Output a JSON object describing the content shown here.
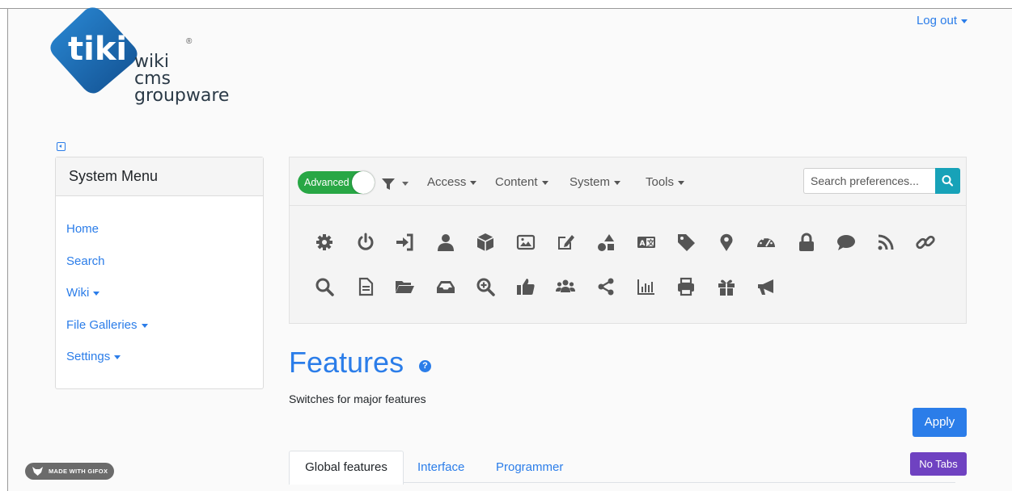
{
  "app": {
    "brand_line1": "wiki",
    "brand_line2": "cms",
    "brand_line3": "groupware",
    "logo_word": "tiki",
    "registered": "®"
  },
  "header": {
    "logout_label": "Log out"
  },
  "sidebar": {
    "title": "System Menu",
    "items": [
      {
        "label": "Home",
        "dropdown": false
      },
      {
        "label": "Search",
        "dropdown": false
      },
      {
        "label": "Wiki",
        "dropdown": true
      },
      {
        "label": "File Galleries",
        "dropdown": true
      },
      {
        "label": "Settings",
        "dropdown": true
      }
    ]
  },
  "admin_bar": {
    "toggle_label": "Advanced",
    "menus": [
      "Access",
      "Content",
      "System",
      "Tools"
    ],
    "search_placeholder": "Search preferences...",
    "icons_row1": [
      "gear-icon",
      "power-icon",
      "login-icon",
      "user-icon",
      "cube-icon",
      "image-icon",
      "edit-icon",
      "shapes-icon",
      "language-icon",
      "tag-icon",
      "map-marker-icon",
      "gauge-icon",
      "lock-icon",
      "comment-icon",
      "rss-icon",
      "link-icon"
    ],
    "icons_row2": [
      "search-icon",
      "file-icon",
      "folder-open-icon",
      "inbox-icon",
      "zoom-in-icon",
      "thumbs-up-icon",
      "users-icon",
      "share-icon",
      "chart-icon",
      "print-icon",
      "gift-icon",
      "megaphone-icon"
    ]
  },
  "main": {
    "title": "Features",
    "subtitle": "Switches for major features",
    "apply_label": "Apply",
    "no_tabs_label": "No Tabs",
    "tabs": [
      "Global features",
      "Interface",
      "Programmer"
    ]
  },
  "badge": {
    "label": "MADE WITH GIFOX"
  },
  "colors": {
    "link": "#2b7de9",
    "toggle_on": "#28a745",
    "search_button": "#17a2b8",
    "no_tabs": "#6f42c1",
    "icon": "#555555",
    "logo": "#1a6fb3"
  }
}
